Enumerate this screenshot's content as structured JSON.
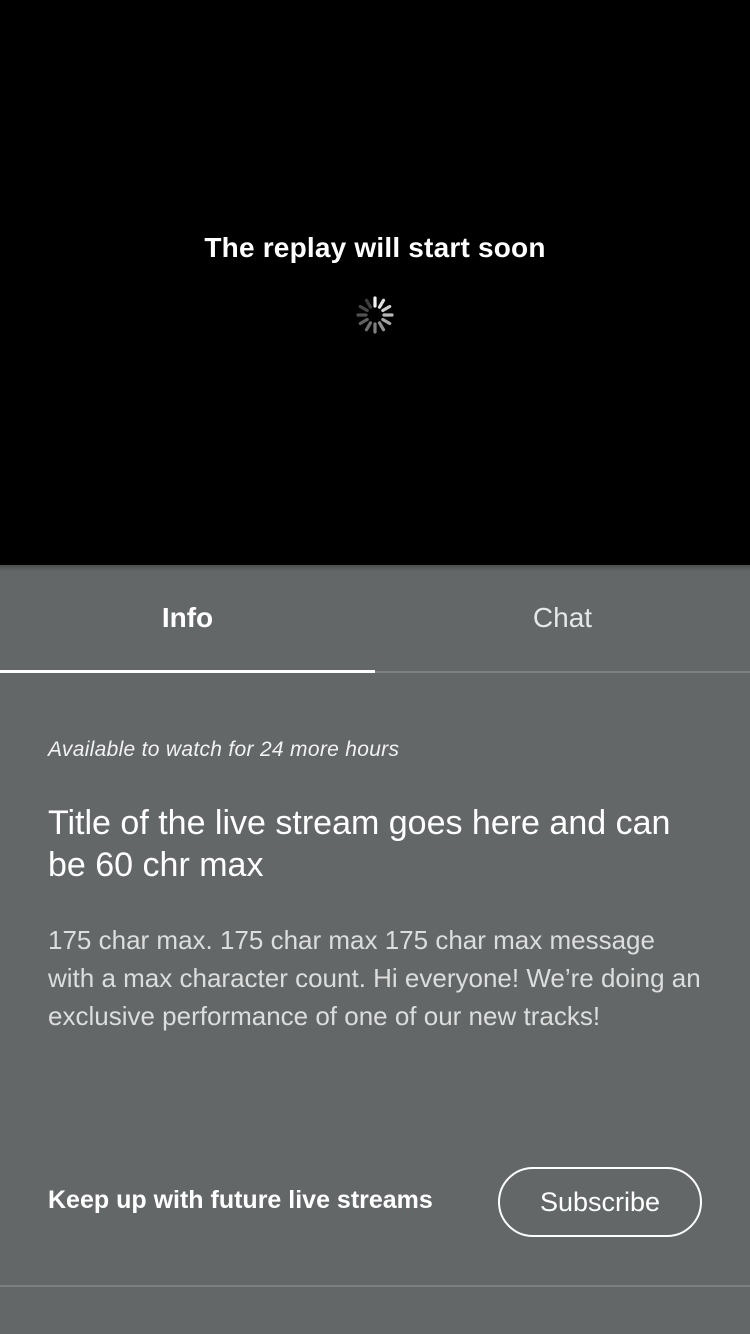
{
  "video": {
    "status_message": "The replay will start soon",
    "spinner_icon": "loading-spinner-icon"
  },
  "tabs": [
    {
      "label": "Info",
      "selected": true
    },
    {
      "label": "Chat",
      "selected": false
    }
  ],
  "info": {
    "availability": "Available to watch for 24 more hours",
    "title": "Title of the live stream goes here and can be 60 chr max",
    "description": "175 char max. 175 char max 175 char max message with a max character count. Hi everyone! We’re doing an exclusive performance of one of our new tracks!"
  },
  "subscribe_section": {
    "prompt": "Keep up with future live streams",
    "button_label": "Subscribe"
  },
  "colors": {
    "video_background": "#000000",
    "panel_background": "#636768",
    "text_primary": "#ffffff",
    "divider": "#7c8081"
  }
}
